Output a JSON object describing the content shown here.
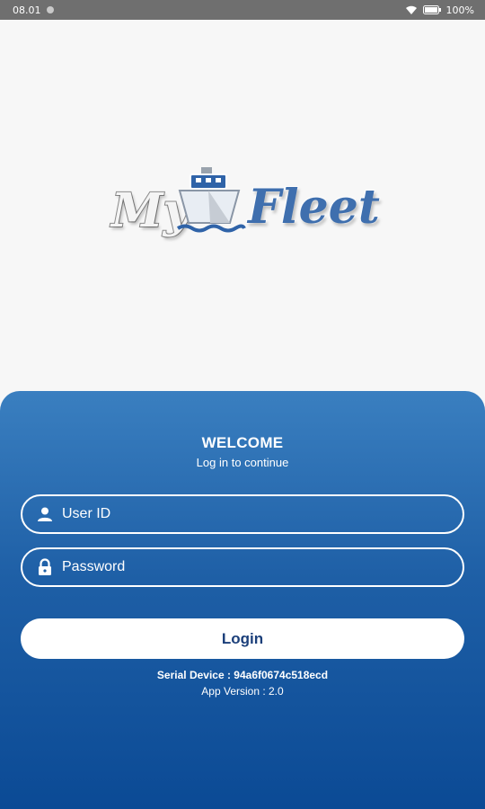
{
  "status_bar": {
    "time": "08.01",
    "battery": "100%"
  },
  "logo": {
    "part1": "My",
    "part2": "Fleet"
  },
  "login": {
    "welcome": "WELCOME",
    "subtitle": "Log in to continue",
    "userid_placeholder": "User ID",
    "password_placeholder": "Password",
    "button_label": "Login",
    "serial_device": "Serial Device : 94a6f0674c518ecd",
    "app_version": "App Version : 2.0"
  },
  "colors": {
    "accent": "#1e5fa6",
    "button_text": "#1b3f7a",
    "statusbar": "#6f6f6f"
  }
}
